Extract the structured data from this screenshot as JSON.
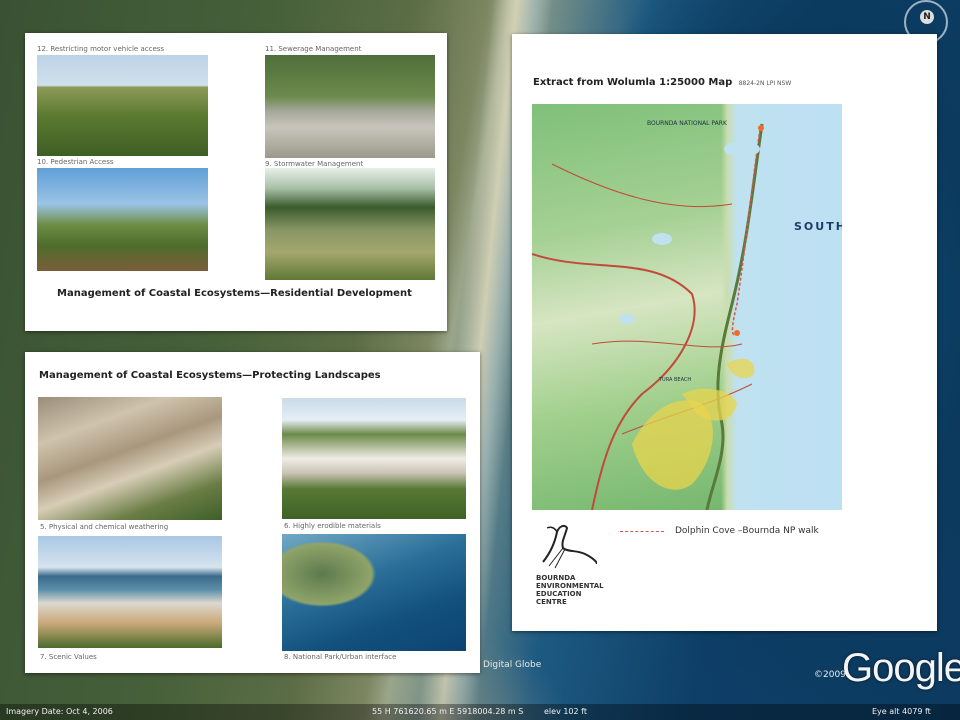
{
  "panel1": {
    "captions": [
      "12. Restricting motor vehicle access",
      "11. Sewerage Management",
      "10. Pedestrian Access",
      "9. Stormwater Management"
    ],
    "title": "Management of Coastal Ecosystems—Residential Development"
  },
  "panel2": {
    "title": "Management of Coastal Ecosystems—Protecting Landscapes",
    "captions": [
      "5. Physical and chemical weathering",
      "6. Highly erodible materials",
      "7. Scenic Values",
      "8. National Park/Urban interface"
    ]
  },
  "panel3": {
    "title": "Extract from Wolumla 1:25000 Map",
    "subtitle": "8824-2N  LPI NSW",
    "map_labels": {
      "park": "BOURNDA NATIONAL PARK",
      "sea": "SOUTH",
      "beach": "TURA BEACH"
    },
    "legend_text": "Dolphin Cove –Bournda NP walk",
    "centre_name": [
      "BOURNDA",
      "ENVIRONMENTAL",
      "EDUCATION",
      "CENTRE"
    ]
  },
  "earth": {
    "digital_globe": "Digital Globe",
    "copyright": "©2009",
    "brand": "Google",
    "imagery_date": "Imagery Date: Oct 4, 2006",
    "coords": "55 H 761620.65 m E 5918004.28 m S",
    "elev": "elev  102 ft",
    "eye_alt": "Eye alt   4079 ft",
    "compass_label": "N"
  },
  "colors": {
    "walk_line": "#d9534f",
    "marker": "#f36b21",
    "sea": "#bde0f3"
  }
}
